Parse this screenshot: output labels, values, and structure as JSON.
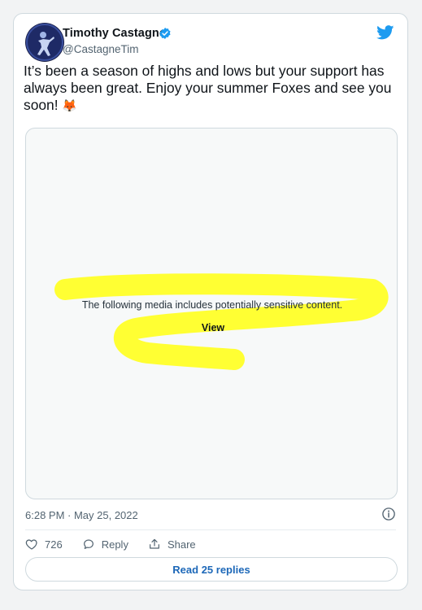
{
  "tweet": {
    "author": {
      "display_name": "Timothy Castagne",
      "handle": "@CastagneTim",
      "verified": true,
      "avatar_icon": "player-avatar"
    },
    "text": "It’s been a season of highs and lows but your support has always been great. Enjoy your summer Foxes and see you soon!",
    "emoji": "🦊",
    "media": {
      "sensitive_notice": "The following media includes potentially sensitive content.",
      "view_label": "View",
      "highlight_color": "#ffff33"
    },
    "timestamp": "6:28 PM · May 25, 2022",
    "actions": {
      "like_count": "726",
      "reply_label": "Reply",
      "share_label": "Share"
    },
    "read_replies_label": "Read 25 replies"
  },
  "colors": {
    "twitter_blue": "#1d9bf0",
    "link_blue": "#1d68b8",
    "muted_text": "#536471"
  }
}
